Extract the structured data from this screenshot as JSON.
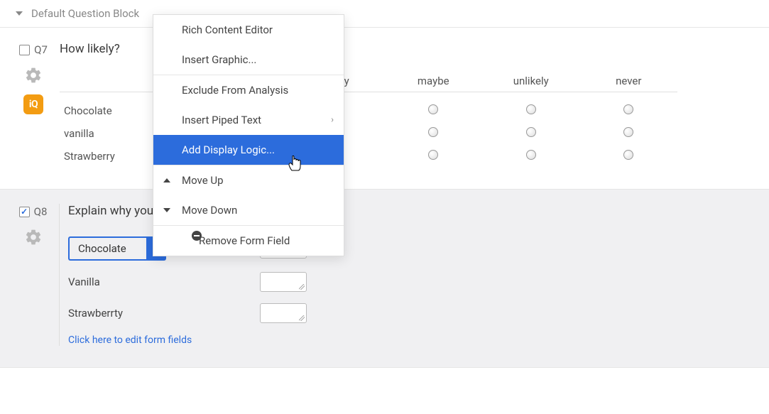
{
  "block_title": "Default Question Block",
  "q7": {
    "id": "Q7",
    "title": "How likely?",
    "checked": false,
    "columns": [
      "",
      "Likely",
      "maybe",
      "unlikely",
      "never"
    ],
    "rows": [
      "Chocolate",
      "vanilla",
      "Strawberry"
    ]
  },
  "q8": {
    "id": "Q8",
    "title": "Explain why you",
    "checked": true,
    "fields": [
      {
        "label": "Chocolate",
        "selected": true
      },
      {
        "label": "Vanilla",
        "selected": false
      },
      {
        "label": "Strawberrty",
        "selected": false
      }
    ],
    "edit_link": "Click here to edit form fields"
  },
  "context_menu": {
    "items": [
      {
        "label": "Rich Content Editor"
      },
      {
        "label": "Insert Graphic..."
      },
      {
        "label": "Exclude From Analysis"
      },
      {
        "label": "Insert Piped Text",
        "submenu": true
      },
      {
        "label": "Add Display Logic...",
        "selected": true
      },
      {
        "label": "Move Up",
        "icon": "up"
      },
      {
        "label": "Move Down",
        "icon": "down"
      },
      {
        "label": "Remove Form Field",
        "icon": "remove"
      }
    ]
  },
  "iq_badge": "iQ"
}
